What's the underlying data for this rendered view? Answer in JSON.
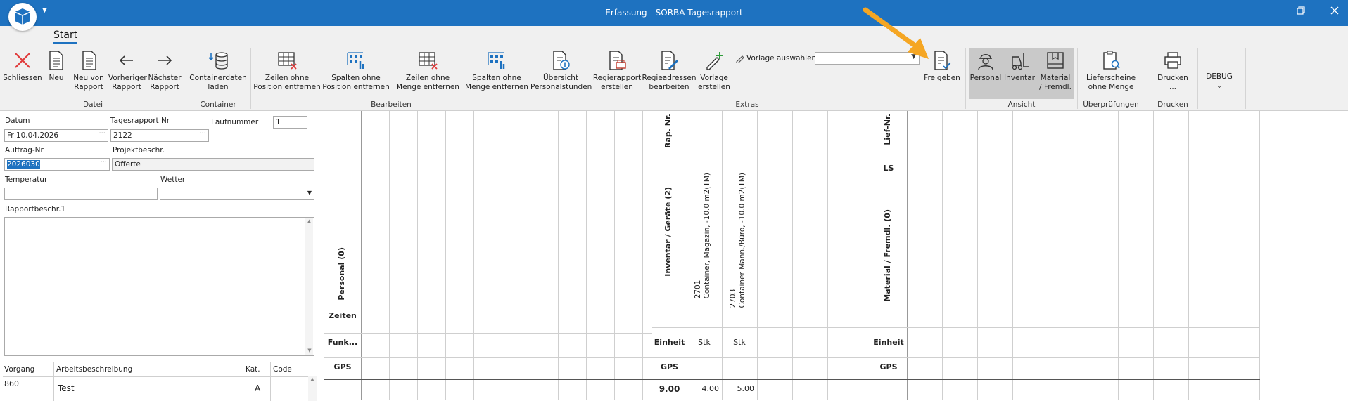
{
  "window": {
    "title": "Erfassung - SORBA Tagesrapport"
  },
  "tabs": [
    "Start"
  ],
  "ribbon": {
    "datei": {
      "group": "Datei",
      "schliessen": "Schliessen",
      "neu": "Neu",
      "neu_von": [
        "Neu von",
        "Rapport"
      ],
      "vorheriger": [
        "Vorheriger",
        "Rapport"
      ],
      "naechster": [
        "Nächster",
        "Rapport"
      ]
    },
    "container": {
      "group": "Container",
      "containerdaten": [
        "Containerdaten",
        "laden"
      ]
    },
    "bearbeiten": {
      "group": "Bearbeiten",
      "zeilen_pos": [
        "Zeilen ohne",
        "Position entfernen"
      ],
      "spalten_pos": [
        "Spalten ohne",
        "Position entfernen"
      ],
      "zeilen_menge": [
        "Zeilen ohne",
        "Menge entfernen"
      ],
      "spalten_menge": [
        "Spalten ohne",
        "Menge entfernen"
      ]
    },
    "extras": {
      "group": "Extras",
      "uebersicht": [
        "Übersicht",
        "Personalstunden"
      ],
      "regierapport": [
        "Regierapport",
        "erstellen"
      ],
      "regieadressen": [
        "Regieadressen",
        "bearbeiten"
      ],
      "vorlage_erstellen": [
        "Vorlage",
        "erstellen"
      ],
      "vorlage_auswaehlen": "Vorlage auswählen",
      "vorlage_value": "",
      "freigeben": "Freigeben"
    },
    "ansicht": {
      "group": "Ansicht",
      "personal": "Personal",
      "inventar": "Inventar",
      "material": [
        "Material",
        "/ Fremdl."
      ]
    },
    "ueberpruefungen": {
      "group": "Überprüfungen",
      "lieferscheine": [
        "Lieferscheine",
        "ohne Menge"
      ]
    },
    "drucken": {
      "group": "Drucken",
      "drucken": [
        "Drucken",
        "..."
      ]
    },
    "debug": "DEBUG"
  },
  "form": {
    "datum": {
      "label": "Datum",
      "value": "Fr 10.04.2026"
    },
    "tagesrapport": {
      "label": "Tagesrapport Nr",
      "value": "2122"
    },
    "laufnummer": {
      "label": "Laufnummer",
      "value": "1"
    },
    "auftrag": {
      "label": "Auftrag-Nr",
      "value": "2026030"
    },
    "projekt": {
      "label": "Projektbeschr.",
      "value": "Offerte"
    },
    "temperatur": {
      "label": "Temperatur",
      "value": ""
    },
    "wetter": {
      "label": "Wetter",
      "value": ""
    },
    "rapportbeschr": {
      "label": "Rapportbeschr.1",
      "value": ""
    }
  },
  "vorgang_table": {
    "columns": [
      "Vorgang",
      "Arbeitsbeschreibung",
      "Kat.",
      "Code"
    ],
    "rows": [
      {
        "vorgang": "860",
        "beschreibung": "Test",
        "kat": "A",
        "code": ""
      }
    ]
  },
  "personal": {
    "header": "Personal (0)",
    "rows": [
      "Zeiten",
      "Funk...",
      "GPS"
    ]
  },
  "inventar": {
    "rap_nr": "Rap. Nr.",
    "header": "Inventar / Geräte (2)",
    "einheit": "Einheit",
    "gps": "GPS",
    "total": "9.00",
    "items": [
      {
        "nr": "2701",
        "name": "Container, Magazin, -10.0 m2(TM)",
        "einheit": "Stk",
        "qty": "4.00"
      },
      {
        "nr": "2703",
        "name": "Container Mann./Büro, -10.0 m2(TM)",
        "einheit": "Stk",
        "qty": "5.00"
      }
    ]
  },
  "material": {
    "lief_nr": "Lief-Nr.",
    "ls": "LS",
    "header": "Material / Fremdl. (0)",
    "einheit": "Einheit",
    "gps": "GPS"
  },
  "colors": {
    "titlebar": "#1e72c0",
    "arrow": "#f5a623",
    "selection": "#1e72c0"
  }
}
